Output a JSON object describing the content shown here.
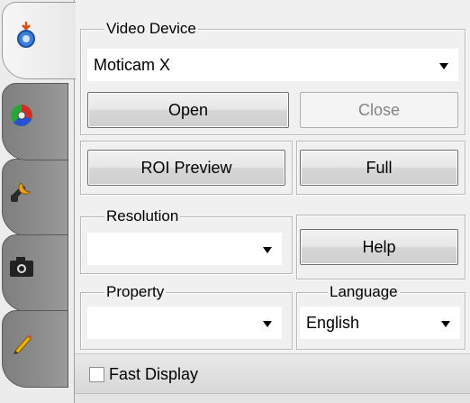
{
  "tabs": [
    {
      "name": "capture-settings",
      "icon": "capture-settings-icon",
      "active": true
    },
    {
      "name": "color",
      "icon": "color-wheel-icon",
      "active": false
    },
    {
      "name": "tools",
      "icon": "tools-icon",
      "active": false
    },
    {
      "name": "snapshot",
      "icon": "camera-icon",
      "active": false
    },
    {
      "name": "annotate",
      "icon": "pencil-icon",
      "active": false
    }
  ],
  "video_device": {
    "legend": "Video Device",
    "selected": "Moticam X",
    "open_label": "Open",
    "close_label": "Close"
  },
  "roi_preview_label": "ROI Preview",
  "full_label": "Full",
  "resolution": {
    "legend": "Resolution",
    "selected": ""
  },
  "help_label": "Help",
  "property": {
    "legend": "Property",
    "selected": ""
  },
  "language": {
    "legend": "Language",
    "selected": "English"
  },
  "fast_display": {
    "label": "Fast Display",
    "checked": false
  }
}
